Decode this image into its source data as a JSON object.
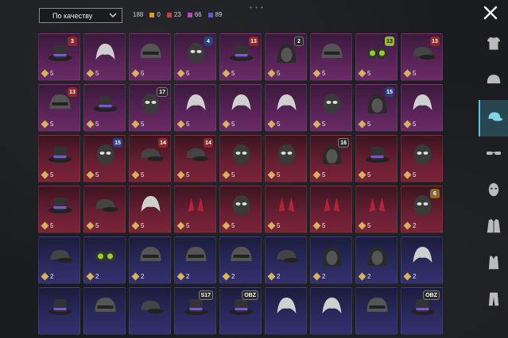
{
  "sort": {
    "label": "По качеству"
  },
  "counters": [
    {
      "value": "188",
      "color": "#9a9a9a"
    },
    {
      "value": "0",
      "color": "#d69a2f"
    },
    {
      "value": "23",
      "color": "#c8413b"
    },
    {
      "value": "66",
      "color": "#b54bbf"
    },
    {
      "value": "89",
      "color": "#6a55c9"
    }
  ],
  "rows": [
    {
      "tint": "purple",
      "items": [
        {
          "cost": "5",
          "badge": "3",
          "badge_style": "b-red",
          "icon": "hat-icon"
        },
        {
          "cost": "5",
          "badge": "",
          "badge_style": "",
          "icon": "hair-icon"
        },
        {
          "cost": "5",
          "badge": "",
          "badge_style": "",
          "icon": "helmet-icon"
        },
        {
          "cost": "5",
          "badge": "4",
          "badge_style": "b-blue",
          "icon": "mask-icon"
        },
        {
          "cost": "5",
          "badge": "13",
          "badge_style": "b-red",
          "icon": "hat-icon"
        },
        {
          "cost": "5",
          "badge": "2",
          "badge_style": "b-dark",
          "icon": "hood-icon"
        },
        {
          "cost": "5",
          "badge": "",
          "badge_style": "",
          "icon": "helmet-icon"
        },
        {
          "cost": "5",
          "badge": "13",
          "badge_style": "b-green",
          "icon": "goggles-icon"
        },
        {
          "cost": "5",
          "badge": "13",
          "badge_style": "b-red",
          "icon": "cap-icon"
        }
      ]
    },
    {
      "tint": "purple",
      "items": [
        {
          "cost": "5",
          "badge": "13",
          "badge_style": "b-red",
          "icon": "helmet-icon"
        },
        {
          "cost": "5",
          "badge": "",
          "badge_style": "",
          "icon": "hat-icon"
        },
        {
          "cost": "5",
          "badge": "17",
          "badge_style": "b-dark",
          "icon": "mask-icon"
        },
        {
          "cost": "5",
          "badge": "",
          "badge_style": "",
          "icon": "hair-icon"
        },
        {
          "cost": "5",
          "badge": "",
          "badge_style": "",
          "icon": "hair-icon"
        },
        {
          "cost": "5",
          "badge": "",
          "badge_style": "",
          "icon": "hair-icon"
        },
        {
          "cost": "5",
          "badge": "",
          "badge_style": "",
          "icon": "mask-icon"
        },
        {
          "cost": "5",
          "badge": "15",
          "badge_style": "b-blue",
          "icon": "hood-icon"
        },
        {
          "cost": "5",
          "badge": "",
          "badge_style": "",
          "icon": "hair-icon"
        }
      ]
    },
    {
      "tint": "red",
      "items": [
        {
          "cost": "5",
          "badge": "",
          "badge_style": "",
          "icon": "hat-icon"
        },
        {
          "cost": "5",
          "badge": "15",
          "badge_style": "b-blue",
          "icon": "mask-icon"
        },
        {
          "cost": "5",
          "badge": "14",
          "badge_style": "b-red",
          "icon": "cap-icon"
        },
        {
          "cost": "5",
          "badge": "14",
          "badge_style": "b-red",
          "icon": "cap-icon"
        },
        {
          "cost": "5",
          "badge": "",
          "badge_style": "",
          "icon": "mask-icon"
        },
        {
          "cost": "5",
          "badge": "",
          "badge_style": "",
          "icon": "mask-icon"
        },
        {
          "cost": "5",
          "badge": "16",
          "badge_style": "b-dark",
          "icon": "hood-icon"
        },
        {
          "cost": "5",
          "badge": "",
          "badge_style": "",
          "icon": "hat-icon"
        },
        {
          "cost": "5",
          "badge": "",
          "badge_style": "",
          "icon": "mask-icon"
        }
      ]
    },
    {
      "tint": "red",
      "items": [
        {
          "cost": "5",
          "badge": "",
          "badge_style": "",
          "icon": "hat-icon"
        },
        {
          "cost": "5",
          "badge": "",
          "badge_style": "",
          "icon": "cap-icon"
        },
        {
          "cost": "5",
          "badge": "",
          "badge_style": "",
          "icon": "hair-icon"
        },
        {
          "cost": "5",
          "badge": "",
          "badge_style": "",
          "icon": "ears-icon"
        },
        {
          "cost": "5",
          "badge": "",
          "badge_style": "",
          "icon": "mask-icon"
        },
        {
          "cost": "5",
          "badge": "",
          "badge_style": "",
          "icon": "ears-icon"
        },
        {
          "cost": "5",
          "badge": "",
          "badge_style": "",
          "icon": "ears-icon"
        },
        {
          "cost": "5",
          "badge": "",
          "badge_style": "",
          "icon": "ears-icon"
        },
        {
          "cost": "2",
          "badge": "6",
          "badge_style": "b-gold",
          "icon": "mask-icon"
        }
      ]
    },
    {
      "tint": "blue",
      "items": [
        {
          "cost": "2",
          "badge": "",
          "badge_style": "",
          "icon": "cap-icon"
        },
        {
          "cost": "2",
          "badge": "",
          "badge_style": "",
          "icon": "goggles-icon"
        },
        {
          "cost": "2",
          "badge": "",
          "badge_style": "",
          "icon": "helmet-icon"
        },
        {
          "cost": "2",
          "badge": "",
          "badge_style": "",
          "icon": "helmet-icon"
        },
        {
          "cost": "2",
          "badge": "",
          "badge_style": "",
          "icon": "helmet-icon"
        },
        {
          "cost": "2",
          "badge": "",
          "badge_style": "",
          "icon": "cap-icon"
        },
        {
          "cost": "2",
          "badge": "",
          "badge_style": "",
          "icon": "hood-icon"
        },
        {
          "cost": "2",
          "badge": "",
          "badge_style": "",
          "icon": "hood-icon"
        },
        {
          "cost": "2",
          "badge": "",
          "badge_style": "",
          "icon": "hair-icon"
        }
      ]
    },
    {
      "tint": "blue",
      "items": [
        {
          "cost": "",
          "badge": "",
          "badge_style": "",
          "icon": "hat-icon"
        },
        {
          "cost": "",
          "badge": "",
          "badge_style": "",
          "icon": "helmet-icon"
        },
        {
          "cost": "",
          "badge": "",
          "badge_style": "",
          "icon": "cap-icon"
        },
        {
          "cost": "",
          "badge": "S17",
          "badge_style": "b-dark",
          "icon": "hat-icon"
        },
        {
          "cost": "",
          "badge": "OBZ",
          "badge_style": "b-dark",
          "icon": "hat-icon"
        },
        {
          "cost": "",
          "badge": "",
          "badge_style": "",
          "icon": "hair-icon"
        },
        {
          "cost": "",
          "badge": "",
          "badge_style": "",
          "icon": "hair-icon"
        },
        {
          "cost": "",
          "badge": "",
          "badge_style": "",
          "icon": "helmet-icon"
        },
        {
          "cost": "",
          "badge": "OBZ",
          "badge_style": "b-dark",
          "icon": "hat-icon"
        }
      ]
    }
  ],
  "sidebar": [
    {
      "icon": "shirt-icon",
      "active": false
    },
    {
      "icon": "helmet-icon",
      "active": false
    },
    {
      "icon": "cap-icon",
      "active": true
    },
    {
      "icon": "glasses-icon",
      "active": false
    },
    {
      "icon": "mask-icon",
      "active": false
    },
    {
      "icon": "jacket-icon",
      "active": false
    },
    {
      "icon": "vest-icon",
      "active": false
    },
    {
      "icon": "pants-icon",
      "active": false
    }
  ]
}
